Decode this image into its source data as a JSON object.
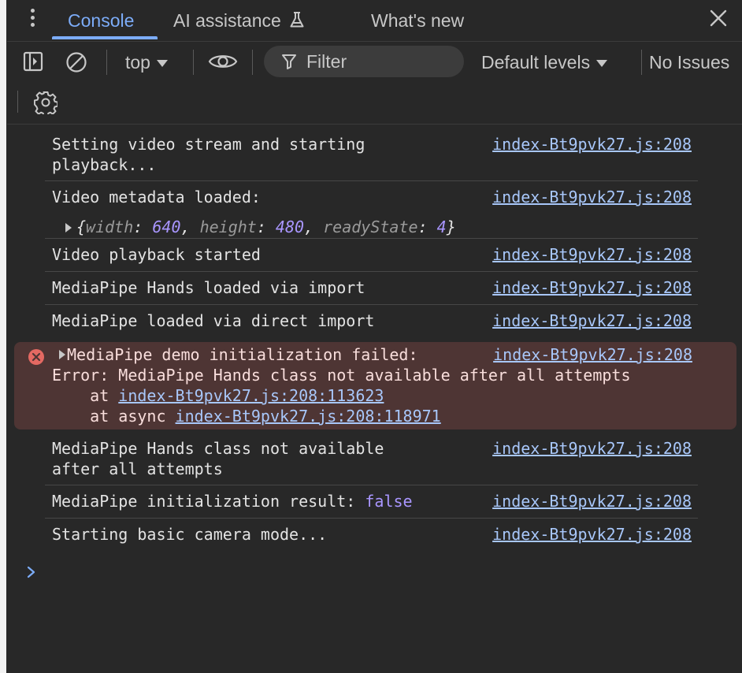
{
  "tabs": [
    {
      "label": "Console",
      "active": true
    },
    {
      "label": "AI assistance",
      "icon": "flask-icon"
    },
    {
      "label": "What's new"
    }
  ],
  "toolbar": {
    "context": "top",
    "filter_placeholder": "Filter",
    "levels": "Default levels",
    "issues": "No Issues"
  },
  "messages": [
    {
      "text": "Setting video stream and starting\nplayback...",
      "source": "index-Bt9pvk27.js:208"
    },
    {
      "text": "Video metadata loaded:",
      "source": "index-Bt9pvk27.js:208",
      "object": {
        "width": "640",
        "height": "480",
        "readyState": "4"
      }
    },
    {
      "text": "Video playback started",
      "source": "index-Bt9pvk27.js:208"
    },
    {
      "text": "MediaPipe Hands loaded via import",
      "source": "index-Bt9pvk27.js:208"
    },
    {
      "text": "MediaPipe loaded via direct import",
      "source": "index-Bt9pvk27.js:208"
    },
    {
      "text": "MediaPipe Hands class not available\nafter all attempts",
      "source": "index-Bt9pvk27.js:208"
    },
    {
      "text": "MediaPipe initialization result: ",
      "value": "false",
      "source": "index-Bt9pvk27.js:208"
    },
    {
      "text": "Starting basic camera mode...",
      "source": "index-Bt9pvk27.js:208"
    }
  ],
  "error": {
    "summary": "MediaPipe demo initialization failed:",
    "source": "index-Bt9pvk27.js:208",
    "message": "Error: MediaPipe Hands class not available after all attempts",
    "stack": [
      {
        "prefix": "    at ",
        "location": "index-Bt9pvk27.js:208:113623"
      },
      {
        "prefix": "    at async ",
        "location": "index-Bt9pvk27.js:208:118971"
      }
    ]
  },
  "colors": {
    "accent": "#7cacf8",
    "link": "#a8c7fa",
    "error_bg": "#4e3534",
    "error_icon": "#e46962",
    "number": "#a996ff"
  }
}
